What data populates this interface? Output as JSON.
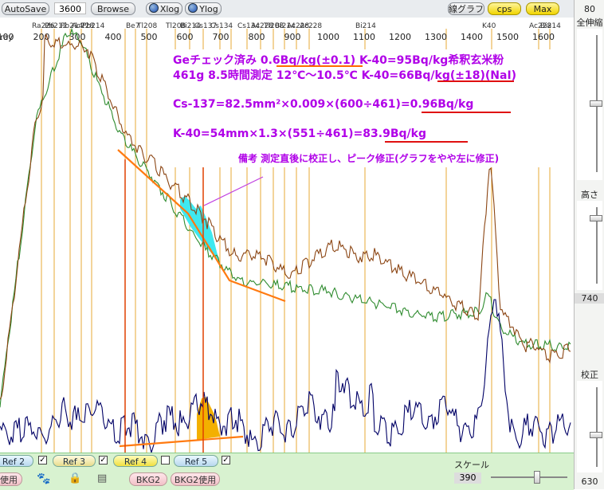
{
  "toolbar": {
    "autosave_label": "AutoSave",
    "time_value": "3600",
    "browse_label": "Browse",
    "xlog_label": "Xlog",
    "ylog_label": "Ylog",
    "linegraph_label": "線グラフ",
    "cps_label": "cps",
    "max_label": "Max"
  },
  "right_panel": {
    "top_value": "80",
    "full_range_label": "全伸縮",
    "height_label": "高さ",
    "height_value": "740",
    "calib_label": "校正",
    "bottom_value": "630"
  },
  "chart_data": {
    "type": "line",
    "x_ticks": [
      "100",
      "200",
      "300",
      "400",
      "500",
      "600",
      "700",
      "800",
      "900",
      "1000",
      "1100",
      "1200",
      "1300",
      "1400",
      "1500",
      "1600"
    ],
    "x_tick_left_label": "ray",
    "nuclide_labels": [
      {
        "text": "Ra226",
        "x": 52
      },
      {
        "text": "Pb212",
        "x": 68
      },
      {
        "text": "Pb214",
        "x": 88
      },
      {
        "text": "Ac228",
        "x": 102
      },
      {
        "text": "Pb214",
        "x": 115
      },
      {
        "text": "Be7",
        "x": 170
      },
      {
        "text": "Tl208",
        "x": 184
      },
      {
        "text": "Tl208",
        "x": 220
      },
      {
        "text": "Bi214",
        "x": 238
      },
      {
        "text": "Cs137",
        "x": 256
      },
      {
        "text": "Cs134",
        "x": 276
      },
      {
        "text": "Cs134",
        "x": 310
      },
      {
        "text": "Ac228",
        "x": 327
      },
      {
        "text": "Tl208",
        "x": 343
      },
      {
        "text": "Bi214",
        "x": 357
      },
      {
        "text": "Ac228",
        "x": 372
      },
      {
        "text": "Ac228",
        "x": 388
      },
      {
        "text": "Bi214",
        "x": 458
      },
      {
        "text": "K40",
        "x": 617
      },
      {
        "text": "Ac228",
        "x": 676
      },
      {
        "text": "Bi214",
        "x": 690
      }
    ],
    "series": [
      {
        "color": "#8b4513",
        "role": "sample (brown)"
      },
      {
        "color": "#2e8b2e",
        "role": "background (green)"
      },
      {
        "color": "#000066",
        "role": "difference (navy)"
      }
    ]
  },
  "annotation": {
    "line1": "Geチェック済み  0.6Bq/kg(±0.1)  K-40=95Bq/kg希釈玄米粉",
    "line2": "461g 8.5時間測定  12℃～10.5℃ K-40=66Bq/kg(±18)(NaI)",
    "line3": "Cs-137=82.5mm²×0.009×(600÷461)=0.96Bq/kg",
    "line4": "K-40=54mm×1.3×(551÷461)=83.9Bq/kg",
    "note": "備考  測定直後に校正し、ピーク修正(グラフをやや左に修正)"
  },
  "bottom": {
    "ref2_label": "Ref 2",
    "ref3_label": "Ref 3",
    "ref4_label": "Ref 4",
    "ref5_label": "Ref 5",
    "use_label": "使用",
    "bkg2_label": "BKG2",
    "bkg2use_label": "BKG2使用",
    "scale_label": "スケール",
    "scale_value": "390"
  }
}
